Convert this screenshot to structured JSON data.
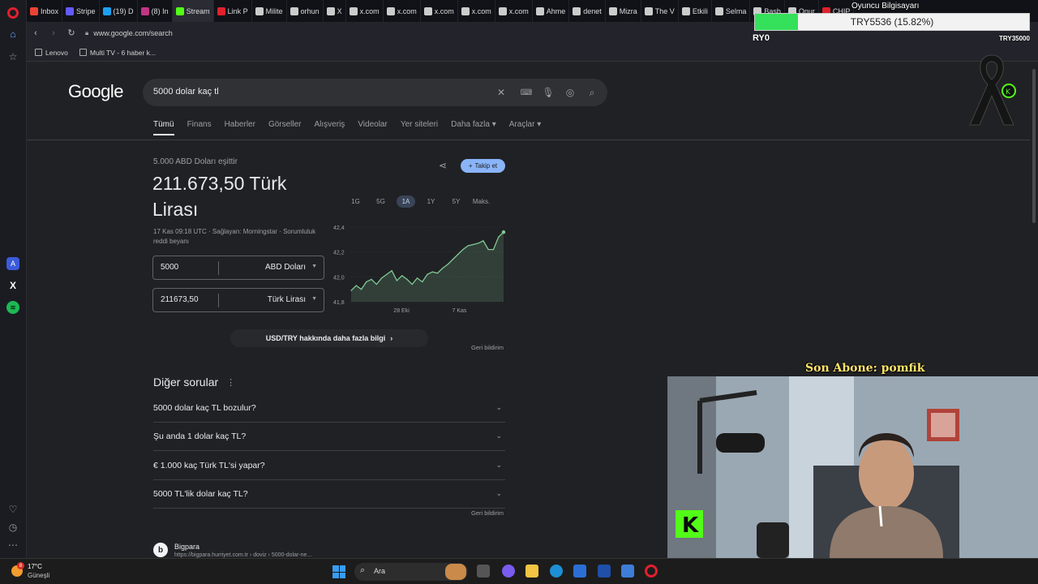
{
  "browser": {
    "tabs": [
      {
        "label": "Inbox",
        "color": "#ea4335"
      },
      {
        "label": "Stripe",
        "color": "#635bff"
      },
      {
        "label": "(19) D",
        "color": "#1da1f2"
      },
      {
        "label": "(8) In",
        "color": "#c13584"
      },
      {
        "label": "Stream",
        "color": "#53fc18"
      },
      {
        "label": "Link P",
        "color": "#e0212d"
      },
      {
        "label": "Milite",
        "color": "#cccccc"
      },
      {
        "label": "orhun",
        "color": "#cccccc"
      },
      {
        "label": "X",
        "color": "#cccccc"
      },
      {
        "label": "x.com",
        "color": "#cccccc"
      },
      {
        "label": "x.com",
        "color": "#cccccc"
      },
      {
        "label": "x.com",
        "color": "#cccccc"
      },
      {
        "label": "x.com",
        "color": "#cccccc"
      },
      {
        "label": "x.com",
        "color": "#cccccc"
      },
      {
        "label": "Ahme",
        "color": "#cccccc"
      },
      {
        "label": "denet",
        "color": "#cccccc"
      },
      {
        "label": "Mizra",
        "color": "#cccccc"
      },
      {
        "label": "The V",
        "color": "#cccccc"
      },
      {
        "label": "Etkili",
        "color": "#cccccc"
      },
      {
        "label": "Selma",
        "color": "#cccccc"
      },
      {
        "label": "Basb",
        "color": "#cccccc"
      },
      {
        "label": "Onur",
        "color": "#cccccc"
      },
      {
        "label": "CHIP",
        "color": "#e0212d"
      }
    ],
    "url": "www.google.com/search",
    "bookmarks": [
      "Lenovo",
      "Multi TV - 6 haber k..."
    ]
  },
  "overlay": {
    "top_label": "Oyuncu Bilgisayarı",
    "bar_text": "TRY5536 (15.82%)",
    "bar_fill_percent": 15.82,
    "bar_fill_color": "#35e05a",
    "left_label": "RY0",
    "right_label": "TRY35000",
    "subscriber": "Son Abone: pomfik"
  },
  "google": {
    "logo": "Google",
    "query": "5000 dolar kaç tl",
    "tabs": [
      "Tümü",
      "Finans",
      "Haberler",
      "Görseller",
      "Alışveriş",
      "Videolar",
      "Yer siteleri",
      "Daha fazla ▾",
      "Araçlar ▾"
    ],
    "active_tab": "Tümü"
  },
  "converter": {
    "caption": "5.000 ABD Doları eşittir",
    "result": "211.673,50 Türk Lirası",
    "follow_label": "Takip et",
    "meta": "17 Kas 09:18 UTC · Sağlayan: Morningstar · Sorumluluk reddi beyanı",
    "from_value": "5000",
    "from_currency": "ABD Doları",
    "to_value": "211673,50",
    "to_currency": "Türk Lirası",
    "ranges": [
      "1G",
      "5G",
      "1A",
      "1Y",
      "5Y",
      "Maks."
    ],
    "active_range": "1A",
    "more_info": "USD/TRY hakkında daha fazla bilgi",
    "feedback": "Geri bildirim"
  },
  "chart_data": {
    "type": "area",
    "title": "",
    "xlabel": "",
    "ylabel": "",
    "ylim": [
      41.8,
      42.4
    ],
    "yticks": [
      "42,4",
      "42,2",
      "42,0",
      "41,8"
    ],
    "xticks": [
      "28 Eki",
      "7 Kas"
    ],
    "line_color": "#81c995",
    "values": [
      41.89,
      41.93,
      41.9,
      41.96,
      41.98,
      41.94,
      41.99,
      42.02,
      42.05,
      41.97,
      42.01,
      41.98,
      41.94,
      41.99,
      41.96,
      42.02,
      42.04,
      42.03,
      42.07,
      42.1,
      42.14,
      42.18,
      42.22,
      42.25,
      42.26,
      42.27,
      42.29,
      42.22,
      42.22,
      42.32,
      42.36
    ]
  },
  "people_also_ask": {
    "title": "Diğer sorular",
    "questions": [
      "5000 dolar kaç TL bozulur?",
      "Şu anda 1 dolar kaç TL?",
      "€ 1.000 kaç Türk TL'si yapar?",
      "5000 TL'lik dolar kaç TL?"
    ],
    "feedback": "Geri bildirim"
  },
  "result": {
    "site": "Bigpara",
    "url": "https://bigpara.hurriyet.com.tr › doviz › 5000-dolar-ne..."
  },
  "taskbar": {
    "temperature": "17°C",
    "weather": "Güneşli",
    "notification_count": "8",
    "search_placeholder": "Ara"
  }
}
